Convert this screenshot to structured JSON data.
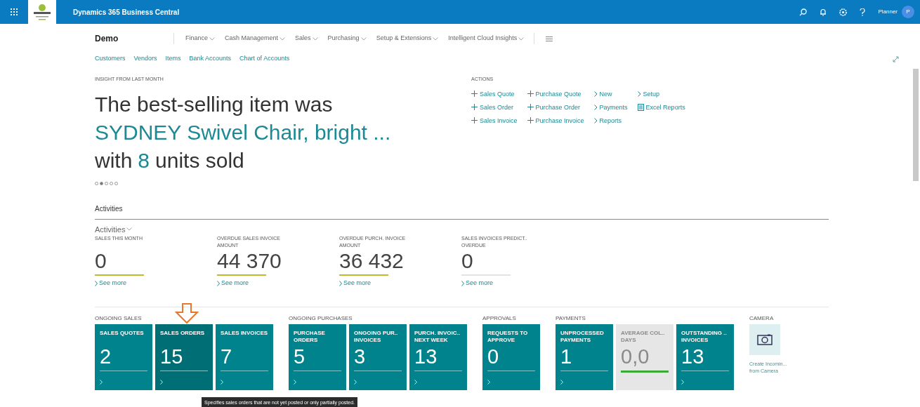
{
  "top_bar": {
    "app_title": "Dynamics 365 Business Central",
    "user": "Planner",
    "avatar": "P"
  },
  "nav": {
    "company": "Demo",
    "menus": [
      "Finance",
      "Cash Management",
      "Sales",
      "Purchasing",
      "Setup & Extensions",
      "Intelligent Cloud Insights"
    ],
    "links": [
      "Customers",
      "Vendors",
      "Items",
      "Bank Accounts",
      "Chart of Accounts"
    ]
  },
  "insight": {
    "label": "INSIGHT FROM LAST MONTH",
    "line_1": "The best-selling item was",
    "item": "SYDNEY Swivel Chair, bright ...",
    "line_3_before": "with",
    "count": "8",
    "line_3_after": "units sold",
    "pager": [
      {
        "selected": false
      },
      {
        "selected": true
      },
      {
        "selected": false
      },
      {
        "selected": false
      },
      {
        "selected": false
      }
    ]
  },
  "actions": {
    "title": "ACTIONS",
    "columns": [
      [
        {
          "kind": "new",
          "label": "Sales Quote"
        },
        {
          "kind": "new",
          "label": "Sales Order"
        },
        {
          "kind": "new",
          "label": "Sales Invoice"
        }
      ],
      [
        {
          "kind": "new",
          "label": "Purchase Quote"
        },
        {
          "kind": "new",
          "label": "Purchase Order"
        },
        {
          "kind": "new",
          "label": "Purchase Invoice"
        }
      ],
      [
        {
          "kind": "menu",
          "label": "New"
        },
        {
          "kind": "menu",
          "label": "Payments"
        },
        {
          "kind": "menu",
          "label": "Reports"
        }
      ],
      [
        {
          "kind": "menu",
          "label": "Setup"
        },
        {
          "kind": "report",
          "label": "Excel Reports"
        }
      ]
    ]
  },
  "activities": {
    "section_title": "Activities",
    "group_title": "Activities",
    "cues": [
      {
        "label": "SALES THIS MONTH",
        "value": "0",
        "color": "#c3b92a",
        "link": "See more"
      },
      {
        "label": "OVERDUE SALES INVOICE AMOUNT",
        "value": "44 370",
        "color": "#c3b92a",
        "link": "See more"
      },
      {
        "label": "OVERDUE PURCH. INVOICE AMOUNT",
        "value": "36 432",
        "color": "#c3b92a",
        "link": "See more"
      },
      {
        "label": "SALES INVOICES PREDICT.. OVERDUE",
        "value": "0",
        "color": "#e3e3e3",
        "link": "See more"
      }
    ]
  },
  "tile_groups": [
    {
      "title": "ONGOING SALES",
      "tiles": [
        {
          "kind": "count",
          "label": "SALES QUOTES",
          "value": "2",
          "selected": false
        },
        {
          "kind": "count",
          "label": "SALES ORDERS",
          "value": "15",
          "selected": true
        },
        {
          "kind": "count",
          "label": "SALES INVOICES",
          "value": "7",
          "selected": false
        }
      ]
    },
    {
      "title": "ONGOING PURCHASES",
      "tiles": [
        {
          "kind": "count",
          "label": "PURCHASE ORDERS",
          "value": "5",
          "selected": false
        },
        {
          "kind": "count",
          "label": "ONGOING PUR.. INVOICES",
          "value": "3",
          "selected": false
        },
        {
          "kind": "count",
          "label": "PURCH. INVOIC.. NEXT WEEK",
          "value": "13",
          "selected": false
        }
      ]
    },
    {
      "title": "APPROVALS",
      "tiles": [
        {
          "kind": "count",
          "label": "REQUESTS TO APPROVE",
          "value": "0",
          "selected": false
        }
      ]
    },
    {
      "title": "PAYMENTS",
      "tiles": [
        {
          "kind": "count",
          "label": "UNPROCESSED PAYMENTS",
          "value": "1",
          "selected": false
        },
        {
          "kind": "neutral",
          "label": "AVERAGE COL.. DAYS",
          "value": "0,0",
          "selected": false
        },
        {
          "kind": "count",
          "label": "OUTSTANDING .. INVOICES",
          "value": "13",
          "selected": false
        }
      ]
    },
    {
      "title": "CAMERA",
      "tiles": [
        {
          "kind": "camera",
          "label": "Create Incomin... from Camera",
          "selected": false
        }
      ]
    }
  ],
  "tooltip": "Specifies sales orders that are not yet posted or only partially posted."
}
